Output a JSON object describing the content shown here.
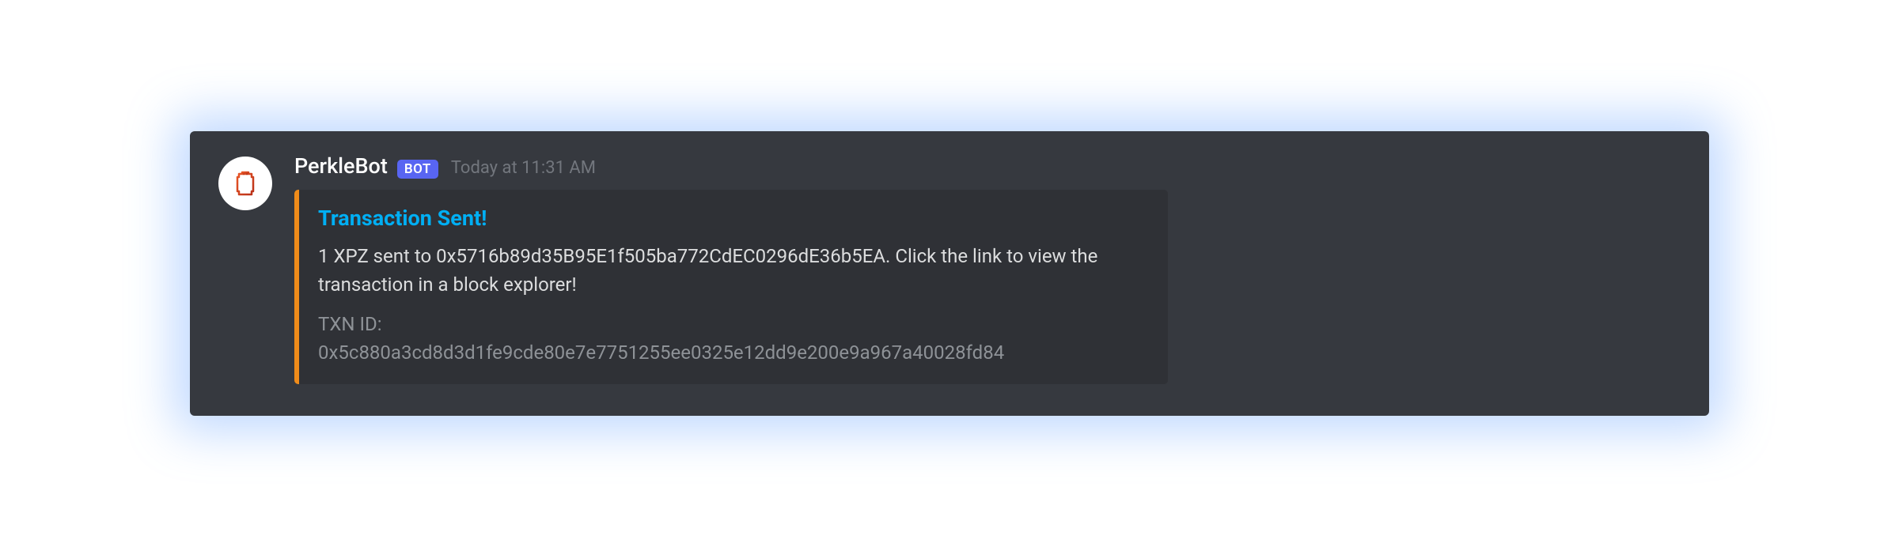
{
  "message": {
    "username": "PerkleBot",
    "bot_badge": "BOT",
    "timestamp": "Today at 11:31 AM"
  },
  "embed": {
    "title": "Transaction Sent!",
    "description": "1 XPZ sent to 0x5716b89d35B95E1f505ba772CdEC0296dE36b5EA. Click the link to view the transaction in a block explorer!",
    "txn_label": "TXN ID:",
    "txn_id": "0x5c880a3cd8d3d1fe9cde80e7e7751255ee0325e12dd9e200e9a967a40028fd84"
  },
  "colors": {
    "embed_border": "#f08c1a",
    "title_color": "#00aff4",
    "bot_badge_bg": "#5865f2"
  }
}
